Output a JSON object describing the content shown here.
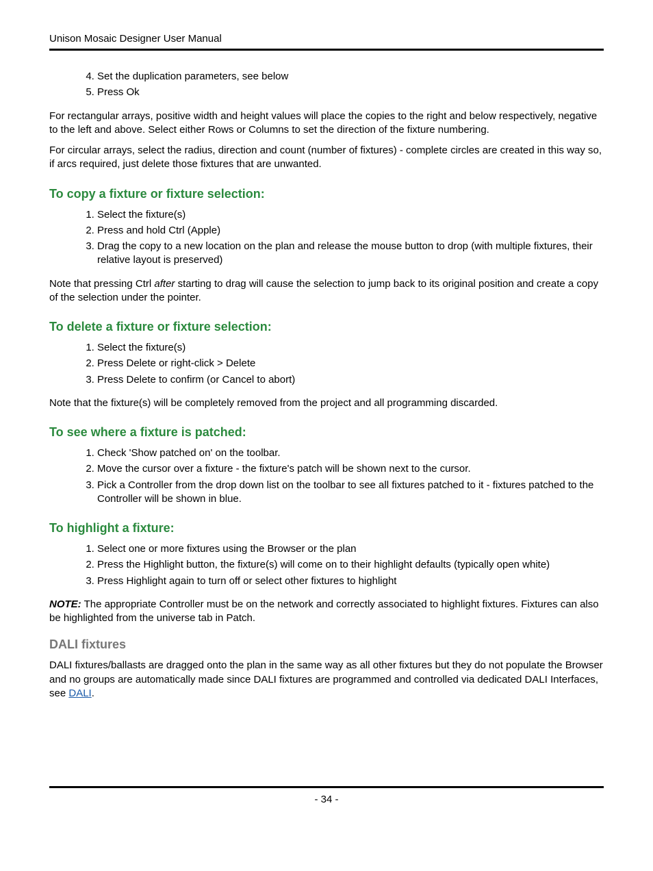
{
  "header": {
    "title": "Unison Mosaic Designer User Manual"
  },
  "intro_list": {
    "start": 4,
    "items": [
      "Set the duplication parameters, see below",
      "Press Ok"
    ]
  },
  "para_rect": "For rectangular arrays, positive width and height values will place the copies to the right and below respectively, negative to the left and above. Select either Rows or Columns to set the direction of the fixture numbering.",
  "para_circ": "For circular arrays, select the radius, direction and count (number of fixtures) - complete circles are created in this way so, if arcs required, just delete those fixtures that are unwanted.",
  "section_copy": {
    "heading": "To copy a fixture or fixture selection:",
    "items": [
      "Select the fixture(s)",
      "Press and hold Ctrl (Apple)",
      "Drag the copy to a new location on the plan and release the mouse button to drop (with multiple fixtures, their relative layout is preserved)"
    ],
    "note_pre": "Note that pressing Ctrl ",
    "note_italic": "after",
    "note_post": " starting to drag will cause the selection to jump back to its original position and create a copy of the selection under the pointer."
  },
  "section_delete": {
    "heading": "To delete a fixture or fixture selection:",
    "items": [
      "Select the fixture(s)",
      "Press Delete or right-click > Delete",
      "Press Delete to confirm (or Cancel to abort)"
    ],
    "note": "Note that the fixture(s) will be completely removed from the project and all programming discarded."
  },
  "section_patched": {
    "heading": "To see where a fixture is patched:",
    "items": [
      "Check 'Show patched on' on the toolbar.",
      "Move the cursor over a fixture - the fixture's patch will be shown next to the cursor.",
      "Pick a Controller from the drop down list on the toolbar to see all fixtures patched to it - fixtures patched to the Controller will be shown in blue."
    ]
  },
  "section_highlight": {
    "heading": "To highlight a fixture:",
    "items": [
      "Select one or more fixtures using the Browser or the plan",
      "Press the Highlight button, the fixture(s) will come on to their highlight defaults (typically open white)",
      "Press Highlight again to turn off or select other fixtures to highlight"
    ],
    "note_label": "NOTE:",
    "note_text": " The appropriate Controller must be on the network and correctly associated to highlight fixtures. Fixtures can also be highlighted from the universe tab in Patch."
  },
  "section_dali": {
    "heading": "DALI fixtures",
    "para_pre": "DALI fixtures/ballasts are dragged onto the plan in the same way as all other fixtures but they do not populate the Browser and no groups are automatically made since DALI fixtures are programmed and controlled via dedicated DALI Interfaces, see ",
    "link_text": "DALI",
    "para_post": "."
  },
  "footer": {
    "page_number": "- 34 -"
  }
}
